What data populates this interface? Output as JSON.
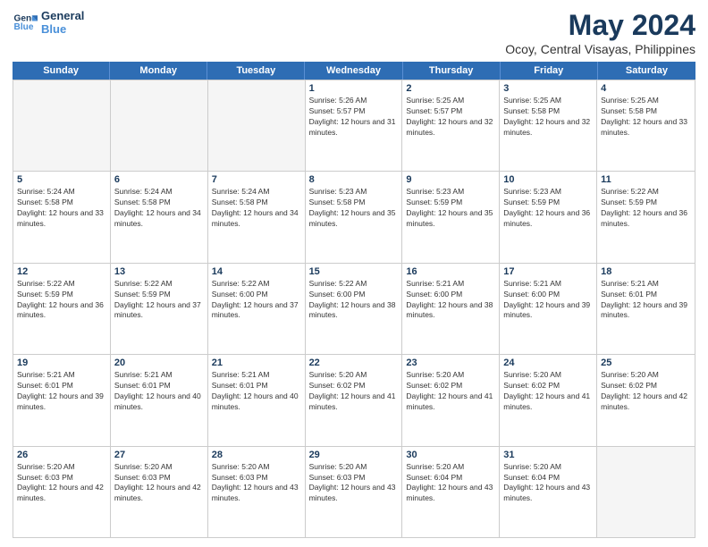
{
  "logo": {
    "line1": "General",
    "line2": "Blue",
    "icon_color": "#4a90d9"
  },
  "header": {
    "title": "May 2024",
    "subtitle": "Ocoy, Central Visayas, Philippines"
  },
  "weekdays": [
    "Sunday",
    "Monday",
    "Tuesday",
    "Wednesday",
    "Thursday",
    "Friday",
    "Saturday"
  ],
  "rows": [
    [
      {
        "day": "",
        "empty": true
      },
      {
        "day": "",
        "empty": true
      },
      {
        "day": "",
        "empty": true
      },
      {
        "day": "1",
        "sunrise": "Sunrise: 5:26 AM",
        "sunset": "Sunset: 5:57 PM",
        "daylight": "Daylight: 12 hours and 31 minutes."
      },
      {
        "day": "2",
        "sunrise": "Sunrise: 5:25 AM",
        "sunset": "Sunset: 5:57 PM",
        "daylight": "Daylight: 12 hours and 32 minutes."
      },
      {
        "day": "3",
        "sunrise": "Sunrise: 5:25 AM",
        "sunset": "Sunset: 5:58 PM",
        "daylight": "Daylight: 12 hours and 32 minutes."
      },
      {
        "day": "4",
        "sunrise": "Sunrise: 5:25 AM",
        "sunset": "Sunset: 5:58 PM",
        "daylight": "Daylight: 12 hours and 33 minutes."
      }
    ],
    [
      {
        "day": "5",
        "sunrise": "Sunrise: 5:24 AM",
        "sunset": "Sunset: 5:58 PM",
        "daylight": "Daylight: 12 hours and 33 minutes."
      },
      {
        "day": "6",
        "sunrise": "Sunrise: 5:24 AM",
        "sunset": "Sunset: 5:58 PM",
        "daylight": "Daylight: 12 hours and 34 minutes."
      },
      {
        "day": "7",
        "sunrise": "Sunrise: 5:24 AM",
        "sunset": "Sunset: 5:58 PM",
        "daylight": "Daylight: 12 hours and 34 minutes."
      },
      {
        "day": "8",
        "sunrise": "Sunrise: 5:23 AM",
        "sunset": "Sunset: 5:58 PM",
        "daylight": "Daylight: 12 hours and 35 minutes."
      },
      {
        "day": "9",
        "sunrise": "Sunrise: 5:23 AM",
        "sunset": "Sunset: 5:59 PM",
        "daylight": "Daylight: 12 hours and 35 minutes."
      },
      {
        "day": "10",
        "sunrise": "Sunrise: 5:23 AM",
        "sunset": "Sunset: 5:59 PM",
        "daylight": "Daylight: 12 hours and 36 minutes."
      },
      {
        "day": "11",
        "sunrise": "Sunrise: 5:22 AM",
        "sunset": "Sunset: 5:59 PM",
        "daylight": "Daylight: 12 hours and 36 minutes."
      }
    ],
    [
      {
        "day": "12",
        "sunrise": "Sunrise: 5:22 AM",
        "sunset": "Sunset: 5:59 PM",
        "daylight": "Daylight: 12 hours and 36 minutes."
      },
      {
        "day": "13",
        "sunrise": "Sunrise: 5:22 AM",
        "sunset": "Sunset: 5:59 PM",
        "daylight": "Daylight: 12 hours and 37 minutes."
      },
      {
        "day": "14",
        "sunrise": "Sunrise: 5:22 AM",
        "sunset": "Sunset: 6:00 PM",
        "daylight": "Daylight: 12 hours and 37 minutes."
      },
      {
        "day": "15",
        "sunrise": "Sunrise: 5:22 AM",
        "sunset": "Sunset: 6:00 PM",
        "daylight": "Daylight: 12 hours and 38 minutes."
      },
      {
        "day": "16",
        "sunrise": "Sunrise: 5:21 AM",
        "sunset": "Sunset: 6:00 PM",
        "daylight": "Daylight: 12 hours and 38 minutes."
      },
      {
        "day": "17",
        "sunrise": "Sunrise: 5:21 AM",
        "sunset": "Sunset: 6:00 PM",
        "daylight": "Daylight: 12 hours and 39 minutes."
      },
      {
        "day": "18",
        "sunrise": "Sunrise: 5:21 AM",
        "sunset": "Sunset: 6:01 PM",
        "daylight": "Daylight: 12 hours and 39 minutes."
      }
    ],
    [
      {
        "day": "19",
        "sunrise": "Sunrise: 5:21 AM",
        "sunset": "Sunset: 6:01 PM",
        "daylight": "Daylight: 12 hours and 39 minutes."
      },
      {
        "day": "20",
        "sunrise": "Sunrise: 5:21 AM",
        "sunset": "Sunset: 6:01 PM",
        "daylight": "Daylight: 12 hours and 40 minutes."
      },
      {
        "day": "21",
        "sunrise": "Sunrise: 5:21 AM",
        "sunset": "Sunset: 6:01 PM",
        "daylight": "Daylight: 12 hours and 40 minutes."
      },
      {
        "day": "22",
        "sunrise": "Sunrise: 5:20 AM",
        "sunset": "Sunset: 6:02 PM",
        "daylight": "Daylight: 12 hours and 41 minutes."
      },
      {
        "day": "23",
        "sunrise": "Sunrise: 5:20 AM",
        "sunset": "Sunset: 6:02 PM",
        "daylight": "Daylight: 12 hours and 41 minutes."
      },
      {
        "day": "24",
        "sunrise": "Sunrise: 5:20 AM",
        "sunset": "Sunset: 6:02 PM",
        "daylight": "Daylight: 12 hours and 41 minutes."
      },
      {
        "day": "25",
        "sunrise": "Sunrise: 5:20 AM",
        "sunset": "Sunset: 6:02 PM",
        "daylight": "Daylight: 12 hours and 42 minutes."
      }
    ],
    [
      {
        "day": "26",
        "sunrise": "Sunrise: 5:20 AM",
        "sunset": "Sunset: 6:03 PM",
        "daylight": "Daylight: 12 hours and 42 minutes."
      },
      {
        "day": "27",
        "sunrise": "Sunrise: 5:20 AM",
        "sunset": "Sunset: 6:03 PM",
        "daylight": "Daylight: 12 hours and 42 minutes."
      },
      {
        "day": "28",
        "sunrise": "Sunrise: 5:20 AM",
        "sunset": "Sunset: 6:03 PM",
        "daylight": "Daylight: 12 hours and 43 minutes."
      },
      {
        "day": "29",
        "sunrise": "Sunrise: 5:20 AM",
        "sunset": "Sunset: 6:03 PM",
        "daylight": "Daylight: 12 hours and 43 minutes."
      },
      {
        "day": "30",
        "sunrise": "Sunrise: 5:20 AM",
        "sunset": "Sunset: 6:04 PM",
        "daylight": "Daylight: 12 hours and 43 minutes."
      },
      {
        "day": "31",
        "sunrise": "Sunrise: 5:20 AM",
        "sunset": "Sunset: 6:04 PM",
        "daylight": "Daylight: 12 hours and 43 minutes."
      },
      {
        "day": "",
        "empty": true
      }
    ]
  ]
}
